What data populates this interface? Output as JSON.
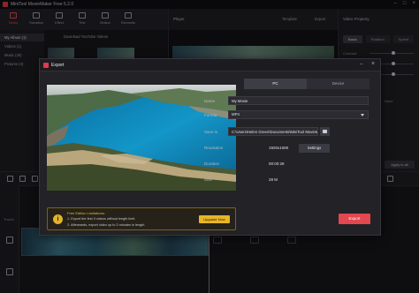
{
  "app": {
    "title": "MiniTool MovieMaker Free 5.2.0",
    "minimize_glyph": "–",
    "maximize_glyph": "□",
    "close_glyph": "×"
  },
  "toolbar": {
    "tools": [
      {
        "label": "Media",
        "icon": "media-icon"
      },
      {
        "label": "Transition",
        "icon": "transition-icon"
      },
      {
        "label": "Effect",
        "icon": "effect-icon"
      },
      {
        "label": "Text",
        "icon": "text-icon"
      },
      {
        "label": "Motion",
        "icon": "motion-icon"
      },
      {
        "label": "Elements",
        "icon": "elements-icon"
      }
    ],
    "active_index": 0
  },
  "media": {
    "side_items": [
      "My Album (1)",
      "Videos (1)",
      "Music (40)",
      "Pictures (4)"
    ],
    "active_index": 0,
    "download_label": "Download YouTube Videos"
  },
  "player": {
    "title": "Player",
    "template_label": "Template",
    "export_label": "Export"
  },
  "properties": {
    "title": "Video Property",
    "tabs": [
      "Basic",
      "Rotation",
      "Speed"
    ],
    "active_tab": 0,
    "rows": [
      {
        "label": "Contrast:"
      },
      {
        "label": "Saturation:"
      },
      {
        "label": "Brightness:"
      }
    ],
    "none_label": "None",
    "apply_all_label": "Apply to all"
  },
  "timeline": {
    "track_label": "Track1"
  },
  "export_dialog": {
    "title": "Export",
    "dest_tabs": [
      "PC",
      "Device"
    ],
    "active_dest": 0,
    "name_label": "Name",
    "name_value": "My Movie",
    "format_label": "Format",
    "format_value": "MP4",
    "save_to_label": "Save to",
    "save_to_value": "C:\\Users\\Helen Green\\Documents\\MiniTool MovieM",
    "resolution_label": "Resolution",
    "resolution_value": "1920x1080",
    "duration_label": "Duration",
    "duration_value": "00:00:28",
    "size_label": "Size",
    "size_value": "28 M",
    "settings_label": "Settings",
    "notice": {
      "title": "Free Edition Limitations:",
      "line1": "1. Export the first 3 videos without length limit.",
      "line2": "2. Afterwards, export video up to 2 minutes in length.",
      "upgrade_label": "Upgrade Now",
      "icon_glyph": "i"
    },
    "export_label": "Export",
    "colors": {
      "accent": "#e3474f",
      "warning": "#e9b526"
    }
  }
}
